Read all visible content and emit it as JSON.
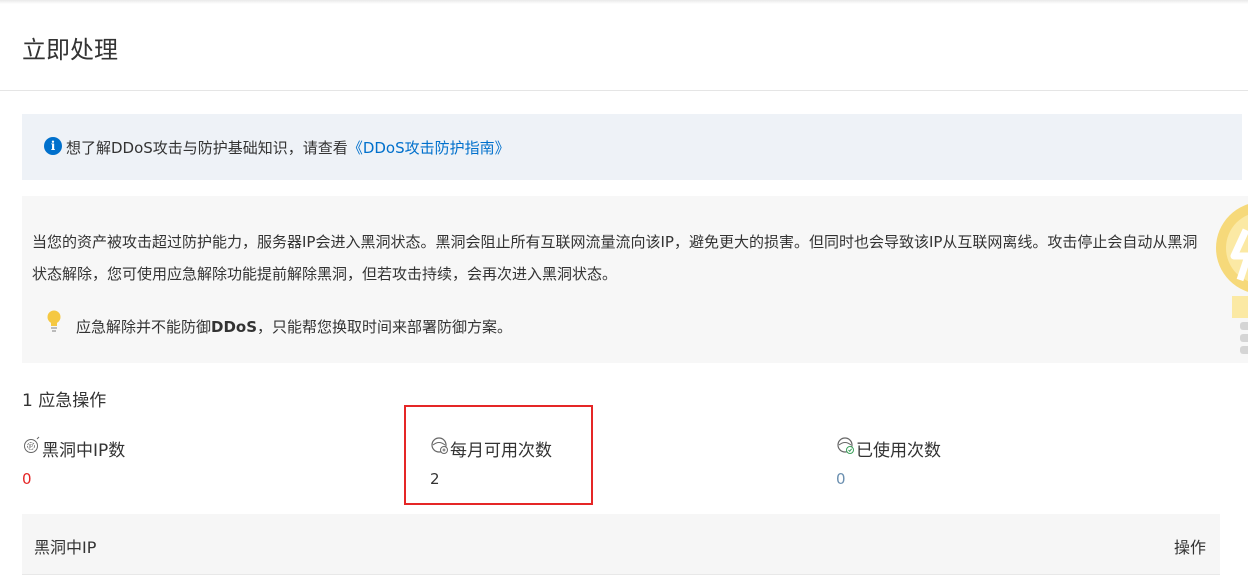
{
  "page": {
    "title": "立即处理"
  },
  "info_banner": {
    "icon": "info-icon",
    "text": "想了解DDoS攻击与防护基础知识，请查看",
    "link": "《DDoS攻击防护指南》",
    "link_color": "#0070cc"
  },
  "notice": {
    "paragraph": "当您的资产被攻击超过防护能力，服务器IP会进入黑洞状态。黑洞会阻止所有互联网流量流向该IP，避免更大的损害。但同时也会导致该IP从互联网离线。攻击停止会自动从黑洞状态解除，您可使用应急解除功能提前解除黑洞，但若攻击持续，会再次进入黑洞状态。",
    "tip_prefix": "应急解除并不能防御",
    "tip_bold": "DDoS",
    "tip_suffix": "，只能帮您换取时间来部署防御方案。",
    "tip_icon": "lightbulb-icon",
    "decoration": "lightbulb-illustration"
  },
  "section": {
    "title": "1 应急操作"
  },
  "stats": [
    {
      "label": "黑洞中IP数",
      "value": "0",
      "color": "#e52626",
      "icon": "blackhole-ip-icon"
    },
    {
      "label": "每月可用次数",
      "value": "2",
      "color": "#333333",
      "icon": "monthly-quota-icon"
    },
    {
      "label": "已使用次数",
      "value": "0",
      "color": "#6b8fb0",
      "icon": "used-count-icon"
    }
  ],
  "table": {
    "columns": [
      "黑洞中IP",
      "操作"
    ]
  },
  "colors": {
    "highlight": "#e52626",
    "accent": "#0070cc"
  }
}
